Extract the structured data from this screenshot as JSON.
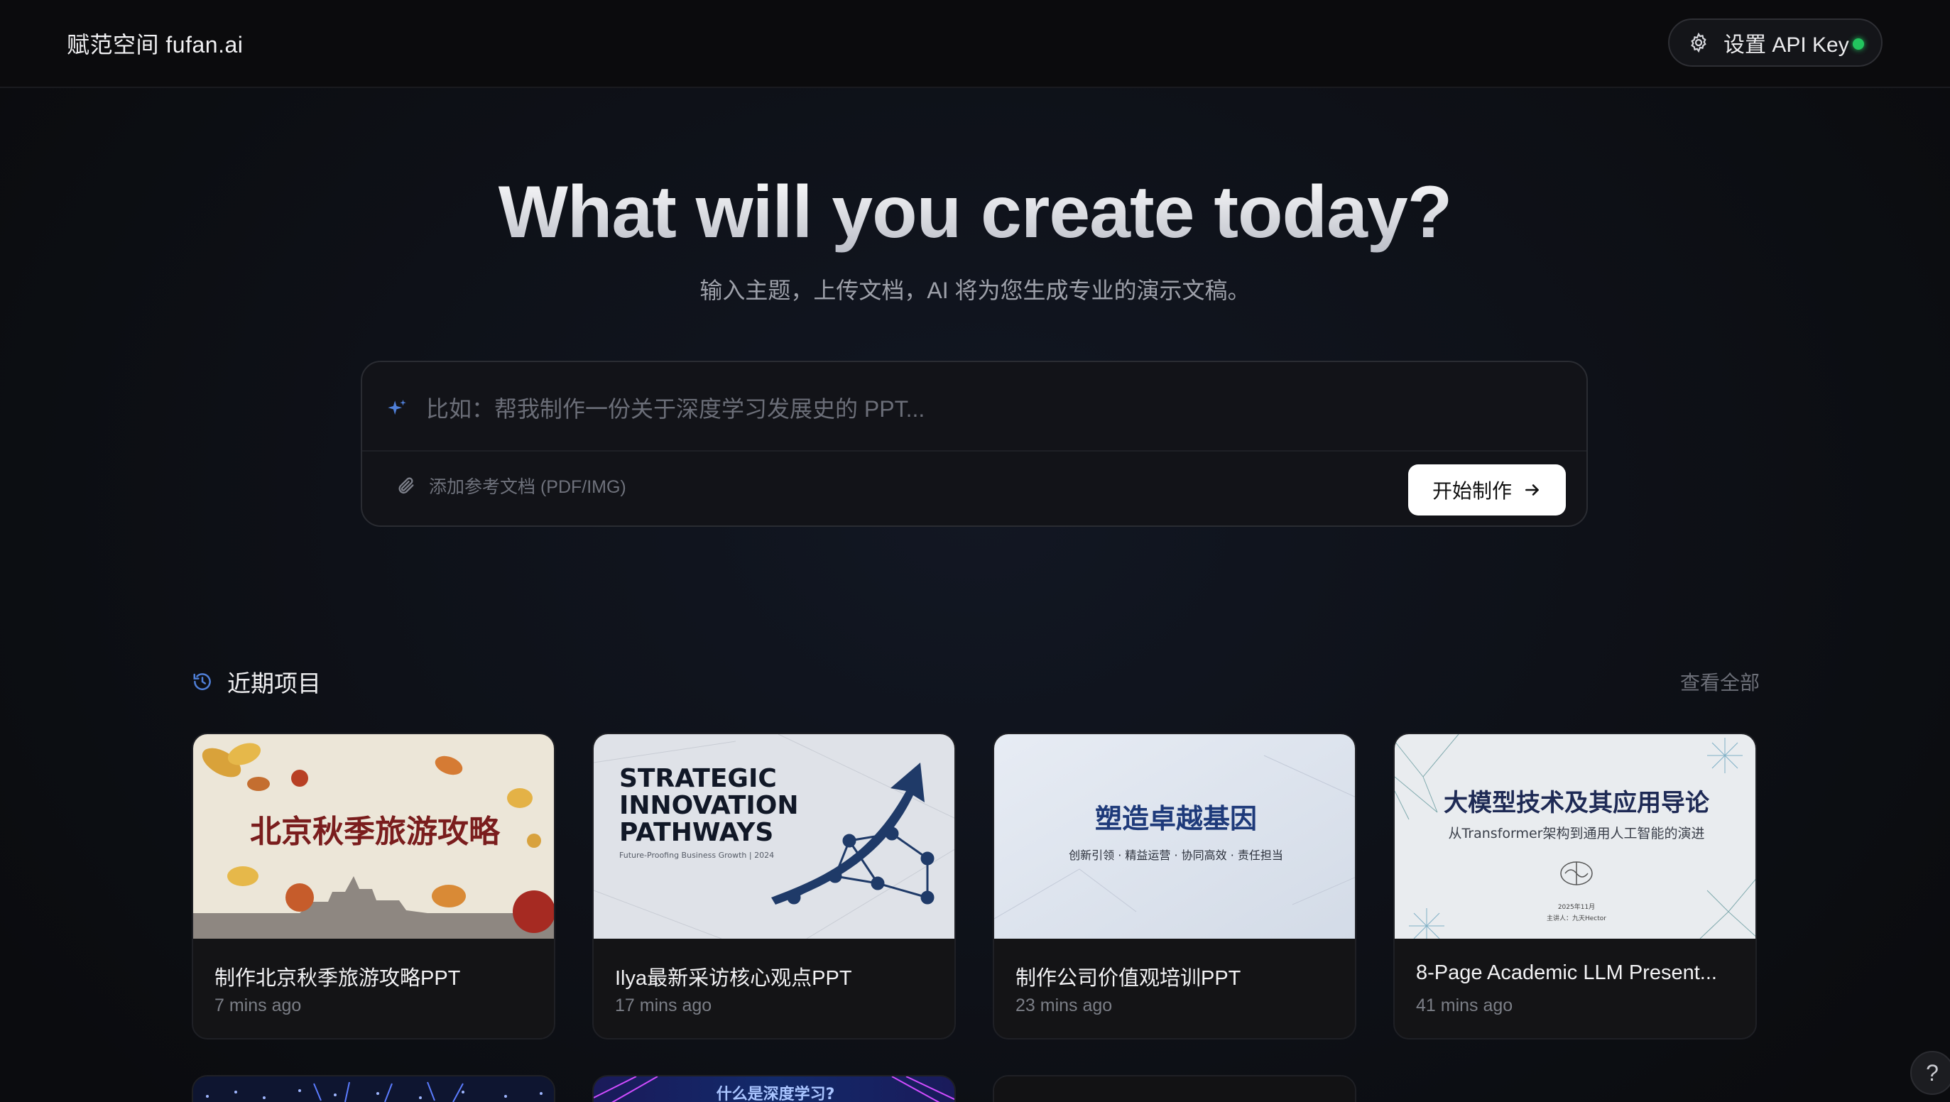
{
  "header": {
    "brand": "赋范空间 fufan.ai",
    "api_button_label": "设置 API Key",
    "api_status_color": "#22c55e"
  },
  "hero": {
    "title": "What will you create today?",
    "subtitle": "输入主题，上传文档，AI 将为您生成专业的演示文稿。"
  },
  "prompt": {
    "placeholder": "比如：帮我制作一份关于深度学习发展史的 PPT...",
    "value": "",
    "attach_label": "添加参考文档 (PDF/IMG)",
    "submit_label": "开始制作"
  },
  "recent": {
    "title": "近期项目",
    "view_all": "查看全部",
    "projects": [
      {
        "name": "制作北京秋季旅游攻略PPT",
        "time": "7 mins ago",
        "thumb_text": "北京秋季旅游攻略"
      },
      {
        "name": "Ilya最新采访核心观点PPT",
        "time": "17 mins ago",
        "thumb_lines": [
          "STRATEGIC",
          "INNOVATION",
          "PATHWAYS"
        ],
        "thumb_sub": "Future-Proofing Business Growth | 2024"
      },
      {
        "name": "制作公司价值观培训PPT",
        "time": "23 mins ago",
        "thumb_title": "塑造卓越基因",
        "thumb_sub": "创新引领 · 精益运营 · 协同高效 · 责任担当"
      },
      {
        "name": "8-Page Academic LLM Present...",
        "time": "41 mins ago",
        "thumb_title": "大模型技术及其应用导论",
        "thumb_sub": "从Transformer架构到通用人工智能的演进",
        "thumb_date": "2025年11月",
        "thumb_author": "主讲人：九天Hector"
      }
    ],
    "partial_thumb_text": "什么是深度学习?"
  },
  "help": {
    "label": "?"
  },
  "colors": {
    "accent_blue": "#3b82f6",
    "background": "#0c0d10",
    "card_bg": "#141416"
  },
  "icons": {
    "settings": "gear-icon",
    "prompt": "sparkle-icon",
    "attach": "paperclip-icon",
    "submit": "arrow-right-icon",
    "recent": "history-icon"
  }
}
